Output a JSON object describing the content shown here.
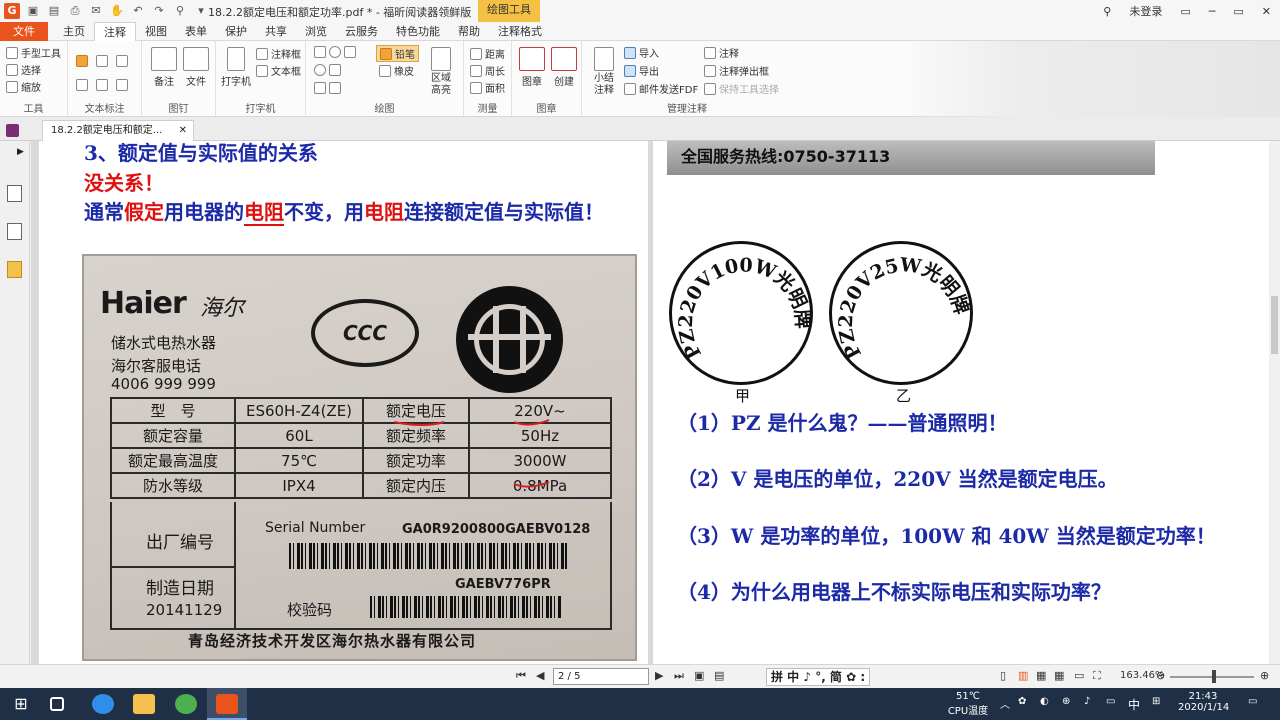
{
  "titlebar": {
    "title": "18.2.2额定电压和额定功率.pdf * - 福昕阅读器领鲜版",
    "context_tab": "绘图工具",
    "user": "未登录"
  },
  "menu": {
    "file": "文件",
    "tabs": [
      "主页",
      "注释",
      "视图",
      "表单",
      "保护",
      "共享",
      "浏览",
      "云服务",
      "特色功能",
      "帮助",
      "注释格式"
    ]
  },
  "ribbon": {
    "tools": {
      "items": [
        "手型工具",
        "选择",
        "缩放"
      ],
      "label": "工具"
    },
    "text_markup": {
      "label": "文本标注"
    },
    "pin": {
      "note": "备注",
      "file": "文件",
      "label": "图钉"
    },
    "typewriter": {
      "type": "打字机",
      "callout": "注释框",
      "textbox": "文本框",
      "label": "打字机"
    },
    "drawing": {
      "pencil": "铅笔",
      "eraser": "橡皮",
      "highlight": "区域高亮",
      "label": "绘图"
    },
    "measure": {
      "distance": "距离",
      "perimeter": "周长",
      "area": "面积",
      "label": "测量"
    },
    "stamp": {
      "stamp": "图章",
      "create": "创建",
      "label": "图章"
    },
    "manage": {
      "summary": "小结注释",
      "import": "导入",
      "export": "导出",
      "email": "邮件发送FDF",
      "notes": "注释",
      "popup": "注释弹出框",
      "keep": "保持工具选择",
      "label": "管理注释"
    }
  },
  "doc_tab": {
    "title": "18.2.2额定电压和额定..."
  },
  "page1": {
    "heading": "3、额定值与实际值的关系",
    "red_line": "没关系！",
    "para_parts": [
      "通常",
      "假定",
      "用电器的",
      "电阻",
      "不变，用",
      "电阻",
      "连接额定值与实际值！"
    ],
    "plate": {
      "brand": "Haier",
      "brand_cn": "海尔",
      "line1": "储水式电热水器",
      "line2": "海尔客服电话",
      "line3": "4006 999 999",
      "ccc": "CCC",
      "table": [
        [
          "型　号",
          "ES60H-Z4(ZE)",
          "额定电压",
          "220V~"
        ],
        [
          "额定容量",
          "60L",
          "额定频率",
          "50Hz"
        ],
        [
          "额定最高温度",
          "75℃",
          "额定功率",
          "3000W"
        ],
        [
          "防水等级",
          "IPX4",
          "额定内压",
          "0.8MPa"
        ]
      ],
      "factory_no_label": "出厂编号",
      "serial_label": "Serial Number",
      "serial_value": "GA0R9200800GAEBV0128",
      "date_label": "制造日期",
      "date_value": "20141129",
      "check_label": "校验码",
      "check_value": "GAEBV776PR",
      "address": "青岛经济技术开发区海尔热水器有限公司"
    }
  },
  "page2": {
    "hotline": "全国服务热线:0750-37113",
    "bulb1": {
      "text": "PZ220V100W光明牌",
      "caption": "甲"
    },
    "bulb2": {
      "text": "PZ220V25W光明牌",
      "caption": "乙"
    },
    "questions": [
      "（1）PZ 是什么鬼？——普通照明！",
      "（2）V 是电压的单位，220V 当然是额定电压。",
      "（3）W 是功率的单位，100W 和 40W 当然是额定功率！",
      "（4）为什么用电器上不标实际电压和实际功率？"
    ]
  },
  "statusbar": {
    "page": "2 / 5",
    "ime": "拼 中 ♪ °, 简 ✿ :",
    "zoom": "163.46%"
  },
  "taskbar": {
    "temp": "51℃",
    "temp_label": "CPU温度",
    "ime": "中",
    "time": "21:43",
    "date": "2020/1/14"
  }
}
